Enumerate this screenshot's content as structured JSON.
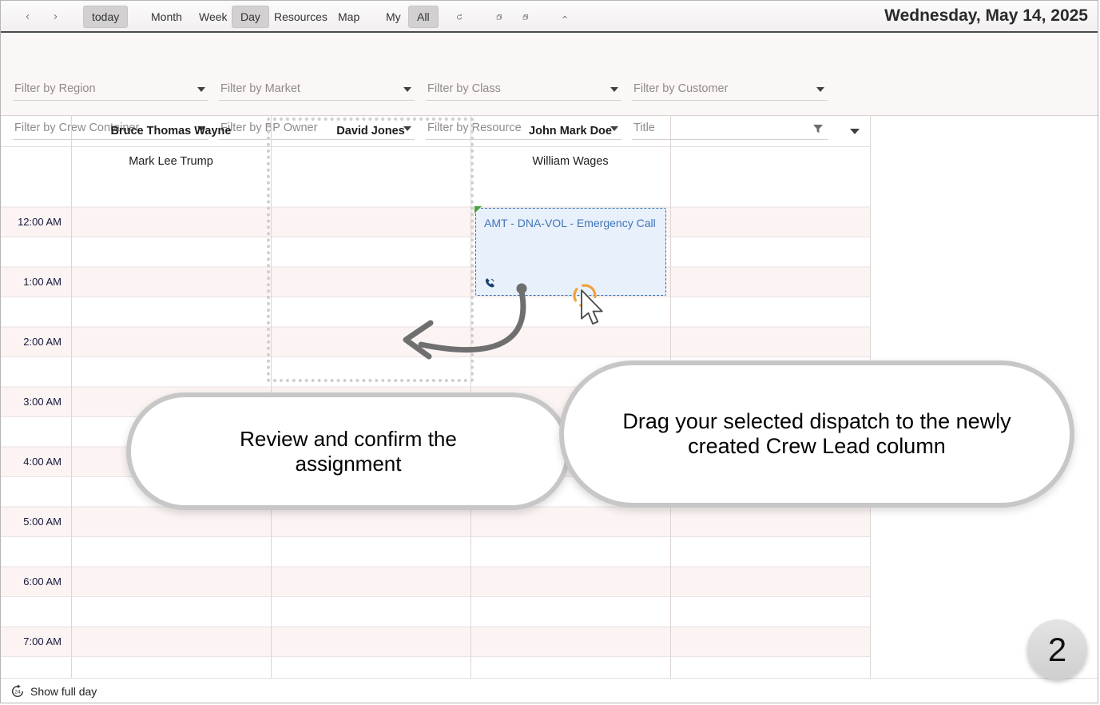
{
  "toolbar": {
    "today": "today",
    "views": {
      "month": "Month",
      "week": "Week",
      "day": "Day",
      "resources": "Resources",
      "map": "Map"
    },
    "scope": {
      "my": "My",
      "all": "All"
    },
    "selected_view": "Day",
    "selected_scope": "All",
    "date_title": "Wednesday, May 14, 2025"
  },
  "filters": {
    "region": "Filter by Region",
    "market": "Filter by Market",
    "class": "Filter by Class",
    "customer": "Filter by Customer",
    "crew_container": "Filter by Crew Container",
    "bp_owner": "Filter by BP Owner",
    "resource": "Filter by Resource",
    "title": "Title"
  },
  "schedule": {
    "columns": [
      {
        "lead": "Bruce Thomas Wayne",
        "member": "Mark Lee Trump"
      },
      {
        "lead": "David Jones",
        "member": ""
      },
      {
        "lead": "John Mark Doe",
        "member": "William Wages"
      },
      {
        "lead": "",
        "member": ""
      }
    ],
    "times": [
      "12:00 AM",
      "1:00 AM",
      "2:00 AM",
      "3:00 AM",
      "4:00 AM",
      "5:00 AM",
      "6:00 AM",
      "7:00 AM"
    ],
    "event": {
      "title": "AMT - DNA-VOL - Emergency Call",
      "column": "John Mark Doe",
      "start": "12:00 AM",
      "end": "1:30 AM"
    }
  },
  "annotations": {
    "callout_review": "Review and confirm the assignment",
    "callout_drag": "Drag your selected dispatch to the newly created Crew Lead column",
    "step_number": "2"
  },
  "footer": {
    "show_full_day": "Show full day"
  },
  "colors": {
    "event_text": "#3f74b8",
    "event_bg": "#e8f0fb",
    "event_border": "#3a6ea5",
    "selected_button_bg": "#d2d0d0",
    "flag_green": "#49a33f",
    "cursor_ring_orange": "#f0a23c"
  }
}
